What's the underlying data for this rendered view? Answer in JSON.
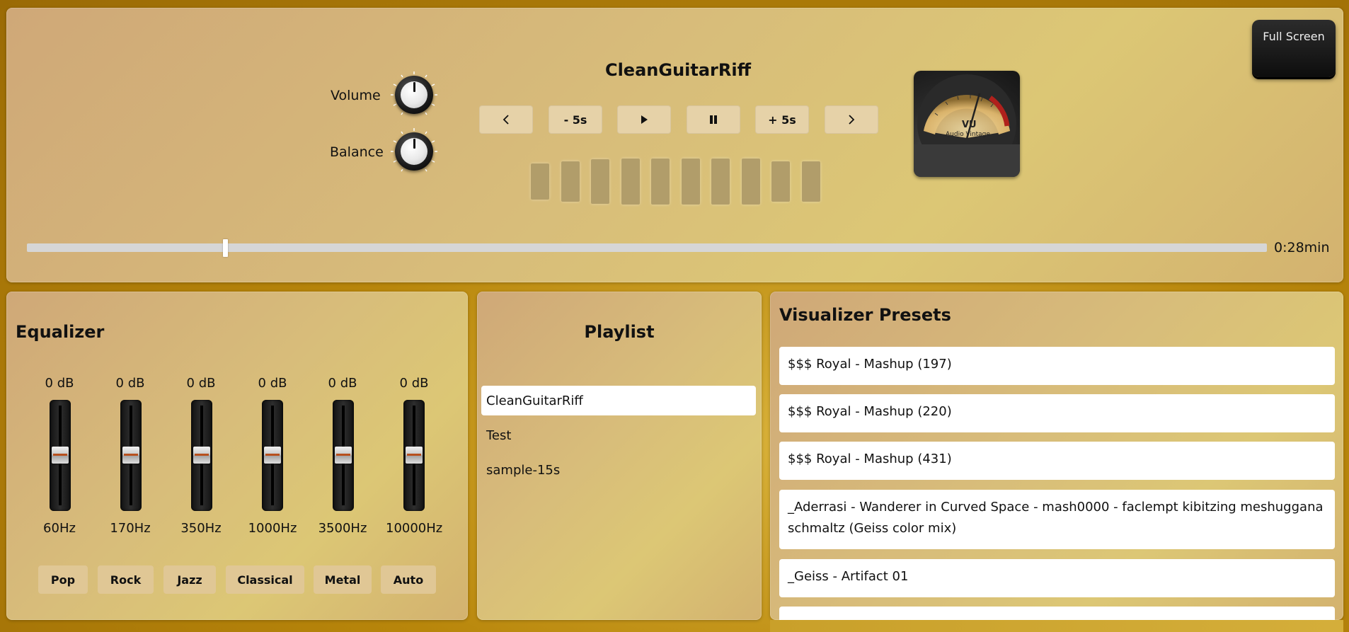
{
  "player": {
    "track_title": "CleanGuitarRiff",
    "volume_label": "Volume",
    "balance_label": "Balance",
    "buttons": {
      "prev": "‹",
      "rewind": "- 5s",
      "play": "▶",
      "pause": "❚❚",
      "forward": "+ 5s",
      "next": "›"
    },
    "full_screen_label": "Full Screen",
    "time": "0:28min",
    "progress_fraction": 0.16,
    "vu_meter": {
      "brand": "Audio Vintage",
      "label": "VU"
    }
  },
  "equalizer": {
    "title": "Equalizer",
    "bands": [
      {
        "db": "0 dB",
        "freq": "60Hz"
      },
      {
        "db": "0 dB",
        "freq": "170Hz"
      },
      {
        "db": "0 dB",
        "freq": "350Hz"
      },
      {
        "db": "0 dB",
        "freq": "1000Hz"
      },
      {
        "db": "0 dB",
        "freq": "3500Hz"
      },
      {
        "db": "0 dB",
        "freq": "10000Hz"
      }
    ],
    "presets": [
      "Pop",
      "Rock",
      "Jazz",
      "Classical",
      "Metal",
      "Auto"
    ]
  },
  "playlist": {
    "title": "Playlist",
    "items": [
      "CleanGuitarRiff",
      "Test",
      "sample-15s"
    ],
    "active_index": 0
  },
  "visualizer": {
    "title": "Visualizer Presets",
    "items": [
      "$$$ Royal - Mashup (197)",
      "$$$ Royal - Mashup (220)",
      "$$$ Royal - Mashup (431)",
      "_Aderrasi - Wanderer in Curved Space - mash0000 - faclempt kibitzing meshuggana schmaltz (Geiss color mix)",
      "_Geiss - Artifact 01"
    ]
  },
  "colors": {
    "background": "#b8860b",
    "panel": "#d8bd7a",
    "button": "#e6d2a8",
    "eq_thumb_line": "#b8501e"
  }
}
